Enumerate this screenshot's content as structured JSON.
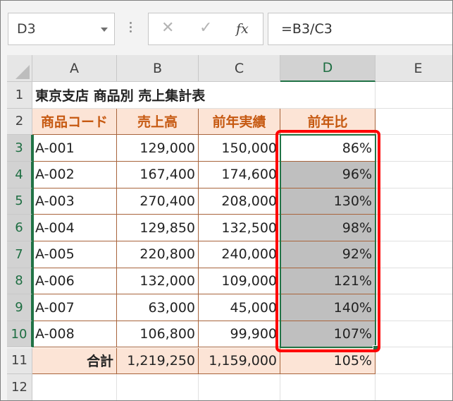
{
  "name_box": {
    "value": "D3"
  },
  "formula_bar": {
    "cancel_glyph": "✕",
    "enter_glyph": "✓",
    "fx_label": "fx",
    "formula": "=B3/C3"
  },
  "columns": [
    "A",
    "B",
    "C",
    "D",
    "E"
  ],
  "rows": [
    "1",
    "2",
    "3",
    "4",
    "5",
    "6",
    "7",
    "8",
    "9",
    "10",
    "11",
    "12"
  ],
  "title": "東京支店 商品別 売上集計表",
  "table_headers": [
    "商品コード",
    "売上高",
    "前年実績",
    "前年比"
  ],
  "table_rows": [
    [
      "A-001",
      "129,000",
      "150,000",
      "86%"
    ],
    [
      "A-002",
      "167,400",
      "174,600",
      "96%"
    ],
    [
      "A-003",
      "270,400",
      "208,000",
      "130%"
    ],
    [
      "A-004",
      "129,850",
      "132,500",
      "98%"
    ],
    [
      "A-005",
      "220,800",
      "240,000",
      "92%"
    ],
    [
      "A-006",
      "132,000",
      "109,000",
      "121%"
    ],
    [
      "A-007",
      "63,000",
      "45,000",
      "140%"
    ],
    [
      "A-008",
      "106,800",
      "99,900",
      "107%"
    ]
  ],
  "total_row": [
    "合計",
    "1,219,250",
    "1,159,000",
    "105%"
  ],
  "colors": {
    "header_fill": "#fce4d6",
    "header_text": "#c65911",
    "selection_green": "#217346",
    "shade_fill": "#bfbfbf",
    "highlight_red": "#ff0000"
  }
}
